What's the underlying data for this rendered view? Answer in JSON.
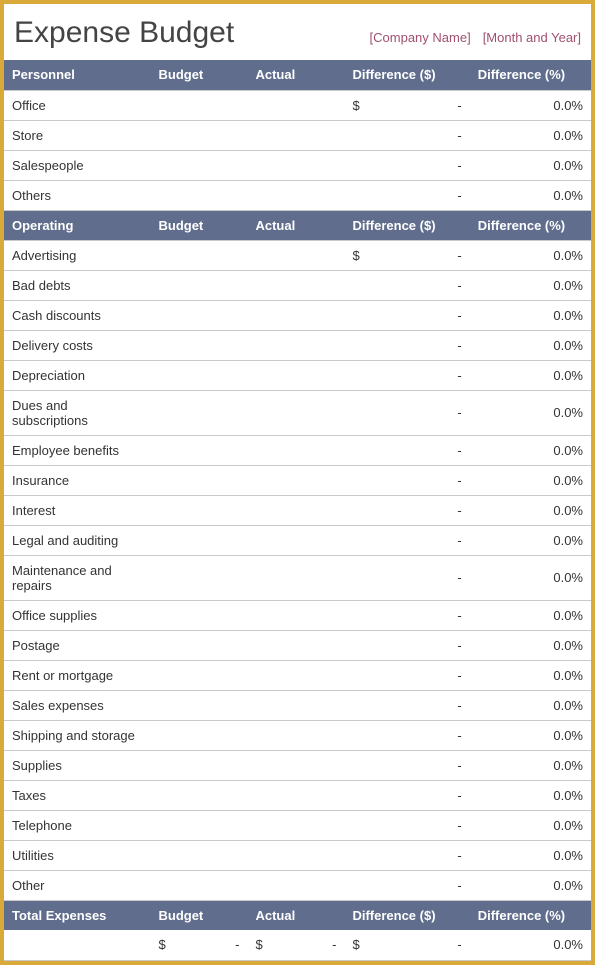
{
  "header": {
    "title": "Expense Budget",
    "company_placeholder": "[Company Name]",
    "date_placeholder": "[Month and Year]"
  },
  "columns": {
    "budget": "Budget",
    "actual": "Actual",
    "diff_dollar": "Difference ($)",
    "diff_pct": "Difference (%)"
  },
  "sections": [
    {
      "name": "Personnel",
      "rows": [
        {
          "label": "Office",
          "budget": "",
          "actual": "",
          "diff_sym": "$",
          "diff_val": "-",
          "diff_pct": "0.0%"
        },
        {
          "label": "Store",
          "budget": "",
          "actual": "",
          "diff_sym": "",
          "diff_val": "-",
          "diff_pct": "0.0%"
        },
        {
          "label": "Salespeople",
          "budget": "",
          "actual": "",
          "diff_sym": "",
          "diff_val": "-",
          "diff_pct": "0.0%"
        },
        {
          "label": "Others",
          "budget": "",
          "actual": "",
          "diff_sym": "",
          "diff_val": "-",
          "diff_pct": "0.0%"
        }
      ]
    },
    {
      "name": "Operating",
      "rows": [
        {
          "label": "Advertising",
          "budget": "",
          "actual": "",
          "diff_sym": "$",
          "diff_val": "-",
          "diff_pct": "0.0%"
        },
        {
          "label": "Bad debts",
          "budget": "",
          "actual": "",
          "diff_sym": "",
          "diff_val": "-",
          "diff_pct": "0.0%"
        },
        {
          "label": "Cash discounts",
          "budget": "",
          "actual": "",
          "diff_sym": "",
          "diff_val": "-",
          "diff_pct": "0.0%"
        },
        {
          "label": "Delivery costs",
          "budget": "",
          "actual": "",
          "diff_sym": "",
          "diff_val": "-",
          "diff_pct": "0.0%"
        },
        {
          "label": "Depreciation",
          "budget": "",
          "actual": "",
          "diff_sym": "",
          "diff_val": "-",
          "diff_pct": "0.0%"
        },
        {
          "label": "Dues and subscriptions",
          "budget": "",
          "actual": "",
          "diff_sym": "",
          "diff_val": "-",
          "diff_pct": "0.0%"
        },
        {
          "label": "Employee benefits",
          "budget": "",
          "actual": "",
          "diff_sym": "",
          "diff_val": "-",
          "diff_pct": "0.0%"
        },
        {
          "label": "Insurance",
          "budget": "",
          "actual": "",
          "diff_sym": "",
          "diff_val": "-",
          "diff_pct": "0.0%"
        },
        {
          "label": "Interest",
          "budget": "",
          "actual": "",
          "diff_sym": "",
          "diff_val": "-",
          "diff_pct": "0.0%"
        },
        {
          "label": "Legal and auditing",
          "budget": "",
          "actual": "",
          "diff_sym": "",
          "diff_val": "-",
          "diff_pct": "0.0%"
        },
        {
          "label": "Maintenance and repairs",
          "budget": "",
          "actual": "",
          "diff_sym": "",
          "diff_val": "-",
          "diff_pct": "0.0%"
        },
        {
          "label": "Office supplies",
          "budget": "",
          "actual": "",
          "diff_sym": "",
          "diff_val": "-",
          "diff_pct": "0.0%"
        },
        {
          "label": "Postage",
          "budget": "",
          "actual": "",
          "diff_sym": "",
          "diff_val": "-",
          "diff_pct": "0.0%"
        },
        {
          "label": "Rent or mortgage",
          "budget": "",
          "actual": "",
          "diff_sym": "",
          "diff_val": "-",
          "diff_pct": "0.0%"
        },
        {
          "label": "Sales expenses",
          "budget": "",
          "actual": "",
          "diff_sym": "",
          "diff_val": "-",
          "diff_pct": "0.0%"
        },
        {
          "label": "Shipping and storage",
          "budget": "",
          "actual": "",
          "diff_sym": "",
          "diff_val": "-",
          "diff_pct": "0.0%"
        },
        {
          "label": "Supplies",
          "budget": "",
          "actual": "",
          "diff_sym": "",
          "diff_val": "-",
          "diff_pct": "0.0%"
        },
        {
          "label": "Taxes",
          "budget": "",
          "actual": "",
          "diff_sym": "",
          "diff_val": "-",
          "diff_pct": "0.0%"
        },
        {
          "label": "Telephone",
          "budget": "",
          "actual": "",
          "diff_sym": "",
          "diff_val": "-",
          "diff_pct": "0.0%"
        },
        {
          "label": "Utilities",
          "budget": "",
          "actual": "",
          "diff_sym": "",
          "diff_val": "-",
          "diff_pct": "0.0%"
        },
        {
          "label": "Other",
          "budget": "",
          "actual": "",
          "diff_sym": "",
          "diff_val": "-",
          "diff_pct": "0.0%"
        }
      ]
    }
  ],
  "total": {
    "label": "Total Expenses",
    "budget_header": "Budget",
    "actual_header": "Actual",
    "diff_dollar_header": "Difference ($)",
    "diff_pct_header": "Difference (%)"
  },
  "total_row": {
    "label": "",
    "budget_sym": "$",
    "budget_val": "-",
    "actual_sym": "$",
    "actual_val": "-",
    "diff_sym": "$",
    "diff_val": "-",
    "diff_pct": "0.0%"
  }
}
